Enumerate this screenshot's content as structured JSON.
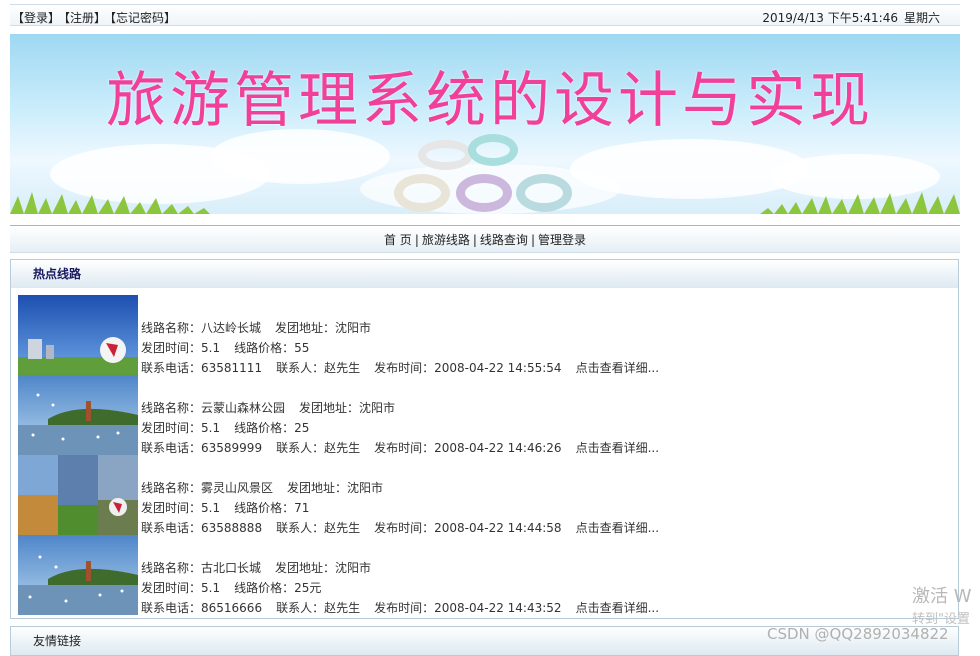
{
  "topbar": {
    "login": "【登录】",
    "register": "【注册】",
    "forgot": "【忘记密码】",
    "datetime": "2019/4/13 下午5:41:46",
    "weekday": "星期六"
  },
  "banner": {
    "title": "旅游管理系统的设计与实现"
  },
  "nav": {
    "home": "首 页",
    "routes": "旅游线路",
    "search": "线路查询",
    "admin": "管理登录",
    "sep": "|"
  },
  "hot": {
    "title": "热点线路",
    "items": [
      {
        "name": "线路名称：八达岭长城",
        "place": "发团地址：沈阳市",
        "time": "发团时间：5.1",
        "price": "线路价格：55",
        "phone": "联系电话：63581111",
        "contact": "联系人：赵先生",
        "publish": "发布时间：2008-04-22 14:55:54",
        "more": "点击查看详细..."
      },
      {
        "name": "线路名称：云蒙山森林公园",
        "place": "发团地址：沈阳市",
        "time": "发团时间：5.1",
        "price": "线路价格：25",
        "phone": "联系电话：63589999",
        "contact": "联系人：赵先生",
        "publish": "发布时间：2008-04-22 14:46:26",
        "more": "点击查看详细..."
      },
      {
        "name": "线路名称：雾灵山风景区",
        "place": "发团地址：沈阳市",
        "time": "发团时间：5.1",
        "price": "线路价格：71",
        "phone": "联系电话：63588888",
        "contact": "联系人：赵先生",
        "publish": "发布时间：2008-04-22 14:44:58",
        "more": "点击查看详细..."
      },
      {
        "name": "线路名称：古北口长城",
        "place": "发团地址：沈阳市",
        "time": "发团时间：5.1",
        "price": "线路价格：25元",
        "phone": "联系电话：86516666",
        "contact": "联系人：赵先生",
        "publish": "发布时间：2008-04-22 14:43:52",
        "more": "点击查看详细..."
      }
    ]
  },
  "links": {
    "title": "友情链接"
  },
  "overlay": {
    "activate": "激活 W",
    "goto": "转到\"设置",
    "csdn": "CSDN @QQ2892034822"
  },
  "colors": {
    "title_pink": "#f0409a",
    "border": "#b7cbd9",
    "sky": "#c9ecfb"
  }
}
